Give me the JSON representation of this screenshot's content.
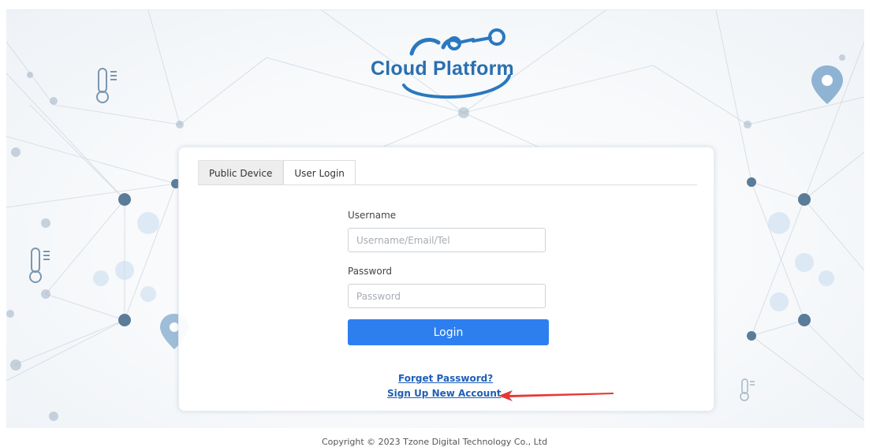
{
  "brand": {
    "name": "Cloud Platform",
    "accent": "#2a6fb0"
  },
  "tabs": [
    {
      "label": "Public Device",
      "active": false
    },
    {
      "label": "User Login",
      "active": true
    }
  ],
  "form": {
    "username_label": "Username",
    "username_placeholder": "Username/Email/Tel",
    "username_value": "",
    "password_label": "Password",
    "password_placeholder": "Password",
    "password_value": "",
    "login_label": "Login",
    "login_color": "#2d7ff0"
  },
  "links": {
    "forgot_password": "Forget Password?",
    "sign_up": "Sign Up New Account"
  },
  "annotation": {
    "arrow_color": "#e53935"
  },
  "footer": {
    "copyright": "Copyright © 2023 Tzone Digital Technology Co., Ltd"
  }
}
